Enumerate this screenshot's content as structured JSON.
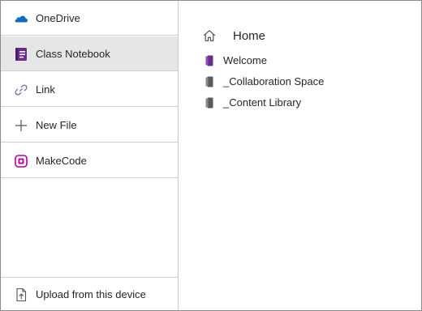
{
  "sidebar": {
    "items": [
      {
        "label": "OneDrive",
        "icon": "onedrive-cloud-icon"
      },
      {
        "label": "Class Notebook",
        "icon": "class-notebook-icon"
      },
      {
        "label": "Link",
        "icon": "link-icon"
      },
      {
        "label": "New File",
        "icon": "plus-icon"
      },
      {
        "label": "MakeCode",
        "icon": "makecode-icon"
      }
    ],
    "selected_index": 1,
    "upload": {
      "label": "Upload from this device",
      "icon": "upload-icon"
    }
  },
  "content": {
    "home": {
      "label": "Home",
      "icon": "home-icon"
    },
    "sections": [
      {
        "label": "Welcome",
        "icon": "notebook-purple-icon"
      },
      {
        "label": "_Collaboration Space",
        "icon": "notebook-gray-icon"
      },
      {
        "label": "_Content Library",
        "icon": "notebook-gray-icon"
      }
    ]
  },
  "colors": {
    "onedrive_blue": "#0f6cbd",
    "notebook_purple": "#6b2c91",
    "makecode_pink": "#b4009e",
    "selected_bg": "#e6e6e6",
    "divider": "#d0d0d0",
    "icon_gray": "#555555"
  }
}
